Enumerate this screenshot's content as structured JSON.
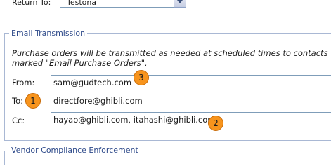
{
  "top_row": {
    "label": "Return To:",
    "selected_value": "Testona"
  },
  "email_transmission": {
    "legend": "Email Transmission",
    "description": "Purchase orders will be transmitted as needed at scheduled times to contacts marked \"Email Purchase Orders\".",
    "from_label": "From:",
    "from_value": "sam@gudtech.com",
    "to_label": "To:",
    "to_value": "directfore@ghibli.com",
    "cc_label": "Cc:",
    "cc_value": "hayao@ghibli.com, itahashi@ghibli.com"
  },
  "vendor_compliance": {
    "legend": "Vendor Compliance Enforcement"
  },
  "callouts": {
    "one": "1",
    "two": "2",
    "three": "3"
  },
  "colors": {
    "callout_fill": "#f7941d",
    "legend_text": "#2e4a8a",
    "input_border": "#7f9db9"
  }
}
